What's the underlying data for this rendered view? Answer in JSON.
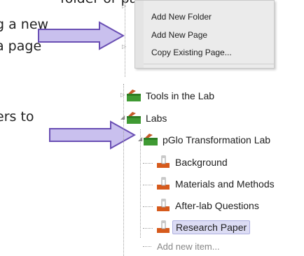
{
  "instructions": [
    "folder or page, click on “Add",
    "g a new",
    "a page",
    "ers to"
  ],
  "context_menu": {
    "items": [
      {
        "label": "Add New Folder"
      },
      {
        "label": "Add New Page"
      },
      {
        "label": "Copy Existing Page..."
      }
    ]
  },
  "tree": {
    "items": [
      {
        "label": "Tools in the Lab",
        "icon": "folder-icon"
      },
      {
        "label": "Labs",
        "icon": "folder-icon"
      },
      {
        "label": "pGlo Transformation Lab",
        "icon": "folder-icon"
      },
      {
        "label": "Background",
        "icon": "page-icon"
      },
      {
        "label": "Materials and Methods",
        "icon": "page-icon"
      },
      {
        "label": "After-lab Questions",
        "icon": "page-icon"
      },
      {
        "label": "Research Paper",
        "icon": "page-icon",
        "selected": true
      },
      {
        "label": "Add new item...",
        "icon": "none"
      }
    ]
  },
  "colors": {
    "arrow_fill": "#c9c0ee",
    "arrow_stroke": "#6a4fb4",
    "selection_bg": "#dcdcf4",
    "folder_green": "#3f9a33",
    "folder_tab_orange": "#c45a2a",
    "page_orange": "#d65a1c"
  }
}
